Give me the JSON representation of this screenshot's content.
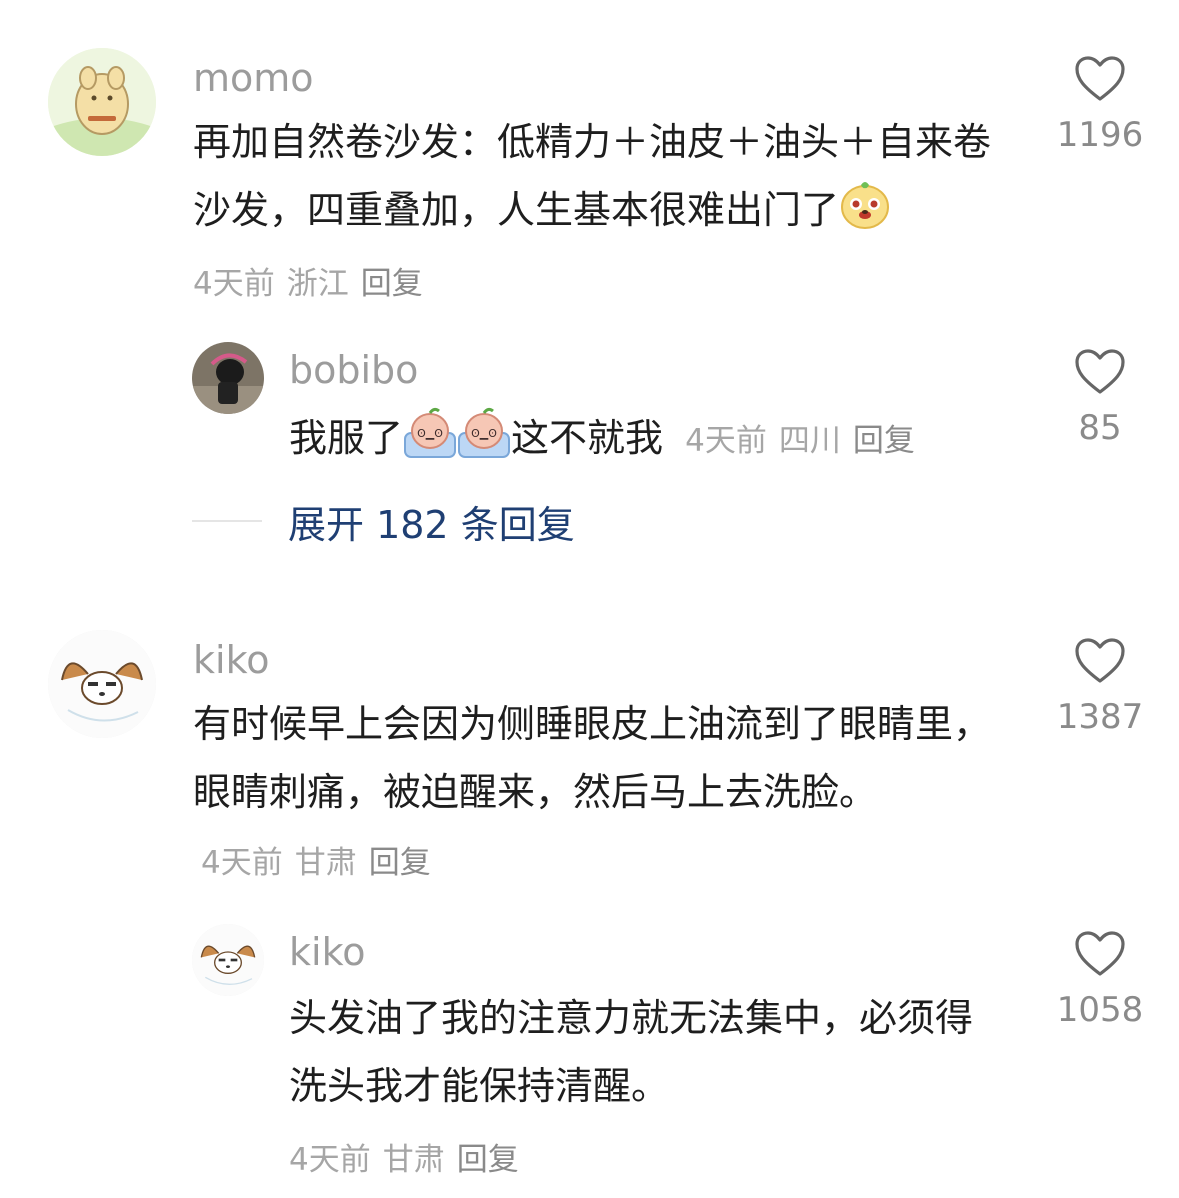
{
  "comments": [
    {
      "username": "momo",
      "text": "再加自然卷沙发：低精力＋油皮＋油头＋自来卷沙发，四重叠加，人生基本很难出门了",
      "time": "4天前",
      "location": "浙江",
      "reply_label": "回复",
      "likes": "1196",
      "emoji": "dog-face-emoji"
    },
    {
      "username": "bobibo",
      "text_before": "我服了",
      "text_after": "这不就我",
      "time": "4天前",
      "location": "四川",
      "reply_label": "回复",
      "likes": "85",
      "emoji": "crying-peach-emoji"
    },
    {
      "username": "kiko",
      "text": "有时候早上会因为侧睡眼皮上油流到了眼睛里，眼睛刺痛，被迫醒来，然后马上去洗脸。",
      "time": "4天前",
      "location": "甘肃",
      "reply_label": "回复",
      "likes": "1387"
    },
    {
      "username": "kiko",
      "text": "头发油了我的注意力就无法集中，必须得洗头我才能保持清醒。",
      "time": "4天前",
      "location": "甘肃",
      "reply_label": "回复",
      "likes": "1058"
    }
  ],
  "expand_replies": "展开 182 条回复",
  "colors": {
    "username": "#9c9c9c",
    "meta": "#a6a6a6",
    "link": "#1f3f73"
  }
}
